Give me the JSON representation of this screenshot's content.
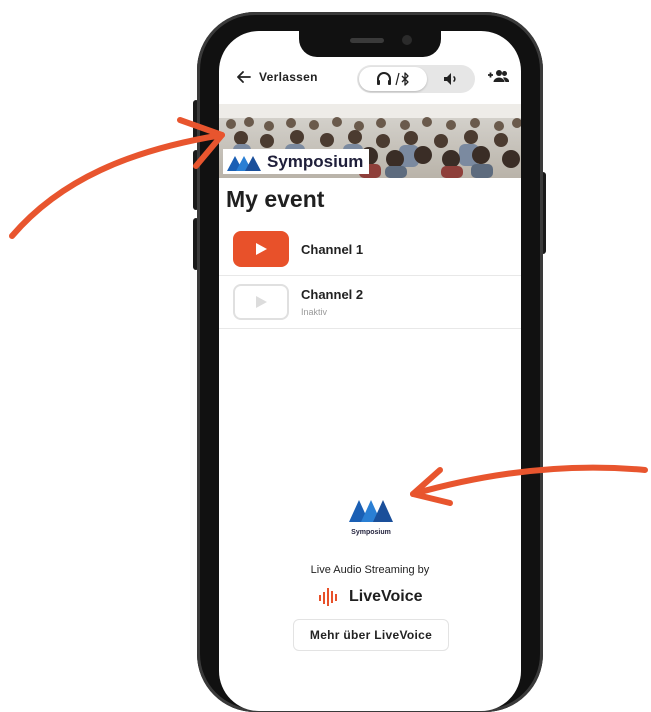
{
  "header": {
    "back_label": "Verlassen",
    "audio_mode_headphones": "headphones-bluetooth-icon",
    "audio_mode_speaker": "speaker-icon",
    "invite_icon": "add-user-icon"
  },
  "banner": {
    "brand": "Symposium"
  },
  "event": {
    "title": "My event"
  },
  "channels": [
    {
      "name": "Channel 1",
      "status": "",
      "active": true
    },
    {
      "name": "Channel 2",
      "status": "Inaktiv",
      "active": false
    }
  ],
  "footer": {
    "logo_text": "Symposium",
    "streaming_by": "Live Audio Streaming by",
    "provider": "LiveVoice",
    "more_button": "Mehr über LiveVoice"
  },
  "colors": {
    "accent": "#e8512a",
    "brand_blue": "#1a5fb4",
    "arrow": "#e8552e"
  }
}
